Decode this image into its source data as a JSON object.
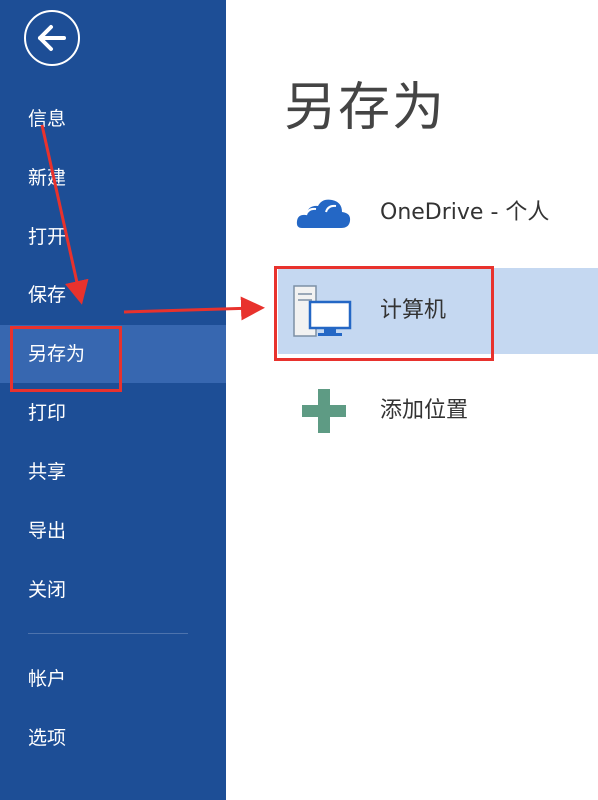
{
  "sidebar": {
    "back_icon": "back-arrow-icon",
    "items": [
      {
        "label": "信息"
      },
      {
        "label": "新建"
      },
      {
        "label": "打开"
      },
      {
        "label": "保存"
      },
      {
        "label": "另存为"
      },
      {
        "label": "打印"
      },
      {
        "label": "共享"
      },
      {
        "label": "导出"
      },
      {
        "label": "关闭"
      },
      {
        "label": "帐户"
      },
      {
        "label": "选项"
      }
    ],
    "active_item": "另存为"
  },
  "main": {
    "title": "另存为",
    "locations": [
      {
        "label": "OneDrive - 个人",
        "icon": "cloud-icon"
      },
      {
        "label": "计算机",
        "icon": "computer-icon",
        "selected": true
      },
      {
        "label": "添加位置",
        "icon": "plus-icon"
      }
    ]
  },
  "colors": {
    "sidebar": "#1d4e96",
    "sidebar_active": "#3767b0",
    "selection": "#c5d8f1",
    "annotation": "#e8322d",
    "cloud": "#2467c5",
    "plus": "#5e9b84"
  }
}
